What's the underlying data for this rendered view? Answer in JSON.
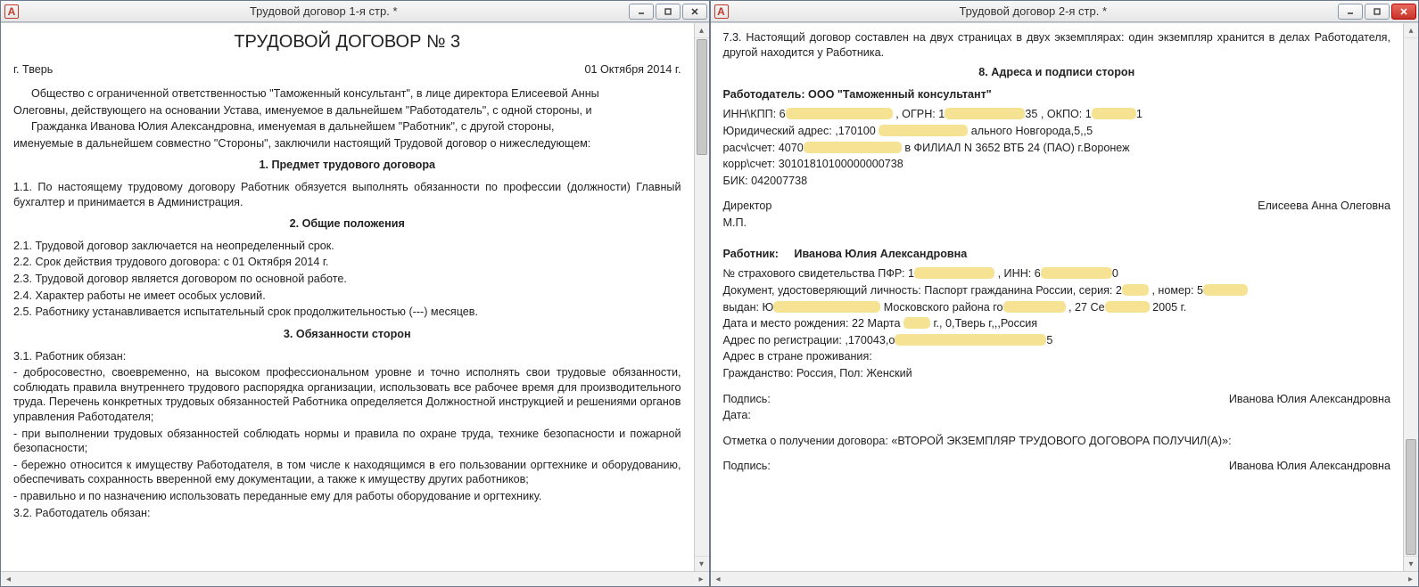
{
  "left": {
    "title": "Трудовой договор 1-я стр. *",
    "doc_title": "ТРУДОВОЙ ДОГОВОР № 3",
    "city": "г. Тверь",
    "date": "01 Октября 2014 г.",
    "preamble_lines": [
      "Общество с ограниченной ответственностью \"Таможенный консультант\", в лице директора Елисеевой Анны",
      "Олеговны, действующего на основании Устава, именуемое в дальнейшем \"Работодатель\", с одной стороны, и",
      "Гражданка Иванова Юлия Александровна, именуемая в дальнейшем \"Работник\", с другой стороны,",
      "именуемые в дальнейшем совместно \"Стороны\", заключили настоящий Трудовой договор о нижеследующем:"
    ],
    "s1_title": "1. Предмет трудового договора",
    "s1_p1": "1.1. По настоящему трудовому договору Работник обязуется выполнять обязанности по профессии (должности) Главный бухгалтер и принимается в Администрация.",
    "s2_title": "2. Общие положения",
    "s2_items": [
      "2.1. Трудовой договор заключается на неопределенный срок.",
      "2.2. Срок действия трудового договора: с 01 Октября 2014 г.",
      "2.3. Трудовой договор является договором по основной работе.",
      "2.4. Характер работы не имеет особых условий.",
      "2.5. Работнику устанавливается испытательный срок продолжительностью (---)  месяцев."
    ],
    "s3_title": "3. Обязанности сторон",
    "s3_1_head": "3.1. Работник обязан:",
    "s3_1_items": [
      "- добросовестно, своевременно, на высоком профессиональном уровне и точно исполнять свои трудовые обязанности, соблюдать правила внутреннего трудового распорядка  организации, использовать все рабочее время для производительного труда. Перечень конкретных трудовых обязанностей Работника определяется Должностной инструкцией и решениями органов управления Работодателя;",
      "- при  выполнении трудовых обязанностей соблюдать нормы и правила по охране труда, технике безопасности и пожарной безопасности;",
      "- бережно  относится к имуществу Работодателя, в том числе к находящимся в его пользовании оргтехнике и оборудованию, обеспечивать сохранность вверенной  ему  документации, а также к имуществу других работников;",
      "- правильно и по назначению использовать переданные ему для работы оборудование и оргтехнику."
    ],
    "s3_2_head": "3.2. Работодатель обязан:"
  },
  "right": {
    "title": "Трудовой договор 2-я стр. *",
    "p73": "7.3. Настоящий договор составлен на двух страницах в двух экземплярах: один экземпляр хранится в делах Работодателя, другой находится у Работника.",
    "s8_title": "8. Адреса и подписи сторон",
    "employer_heading": "Работодатель: ООО \"Таможенный консультант\"",
    "inn_label": "ИНН\\КПП: 6",
    "ogrn_label": ",  ОГРН:  1",
    "okpo_label": ",  ОКПО:  1",
    "okpo_tail": "1",
    "legal_addr_label": "Юридический адрес: ,170100",
    "legal_addr_tail": "ального Новгорода,5,,5",
    "rs_label": "расч\\счет: 4070",
    "rs_tail": "в ФИЛИАЛ N 3652 ВТБ 24 (ПАО) г.Воронеж",
    "ks": "корр\\счет: 30101810100000000738",
    "bik": "БИК: 042007738",
    "director_label": "Директор",
    "director_name": "Елисеева Анна Олеговна",
    "mp": "М.П.",
    "employee_label": "Работник:",
    "employee_name": "Иванова Юлия Александровна",
    "pfr_label": "№ страхового свидетельства ПФР: 1",
    "pfr_mid": ", ИНН: 6",
    "pfr_tail": "0",
    "doc_label": "Документ, удостоверяющий личность: Паспорт гражданина России, серия: 2",
    "doc_num_label": ", номер: 5",
    "issued_label": "выдан: Ю",
    "issued_mid": " Московского района го",
    "issued_tail": ", 27 Се",
    "issued_year": " 2005 г.",
    "birth_label": "Дата и место рождения: 22 Марта ",
    "birth_tail": " г., 0,Тверь г,,,Россия",
    "reg_addr_label": "Адрес по регистрации: ,170043,о",
    "reg_addr_tail": "5",
    "live_addr": "Адрес в стране проживания:",
    "citizenship": "Гражданство: Россия, Пол: Женский",
    "sign_label": "Подпись:",
    "sign_name": "Иванова Юлия Александровна",
    "date_label": "Дата:",
    "receipt": "Отметка о получении договора: «ВТОРОЙ ЭКЗЕМПЛЯР ТРУДОВОГО ДОГОВОРА ПОЛУЧИЛ(А)»:",
    "sign2_label": "Подпись:",
    "sign2_name": "Иванова Юлия Александровна"
  }
}
